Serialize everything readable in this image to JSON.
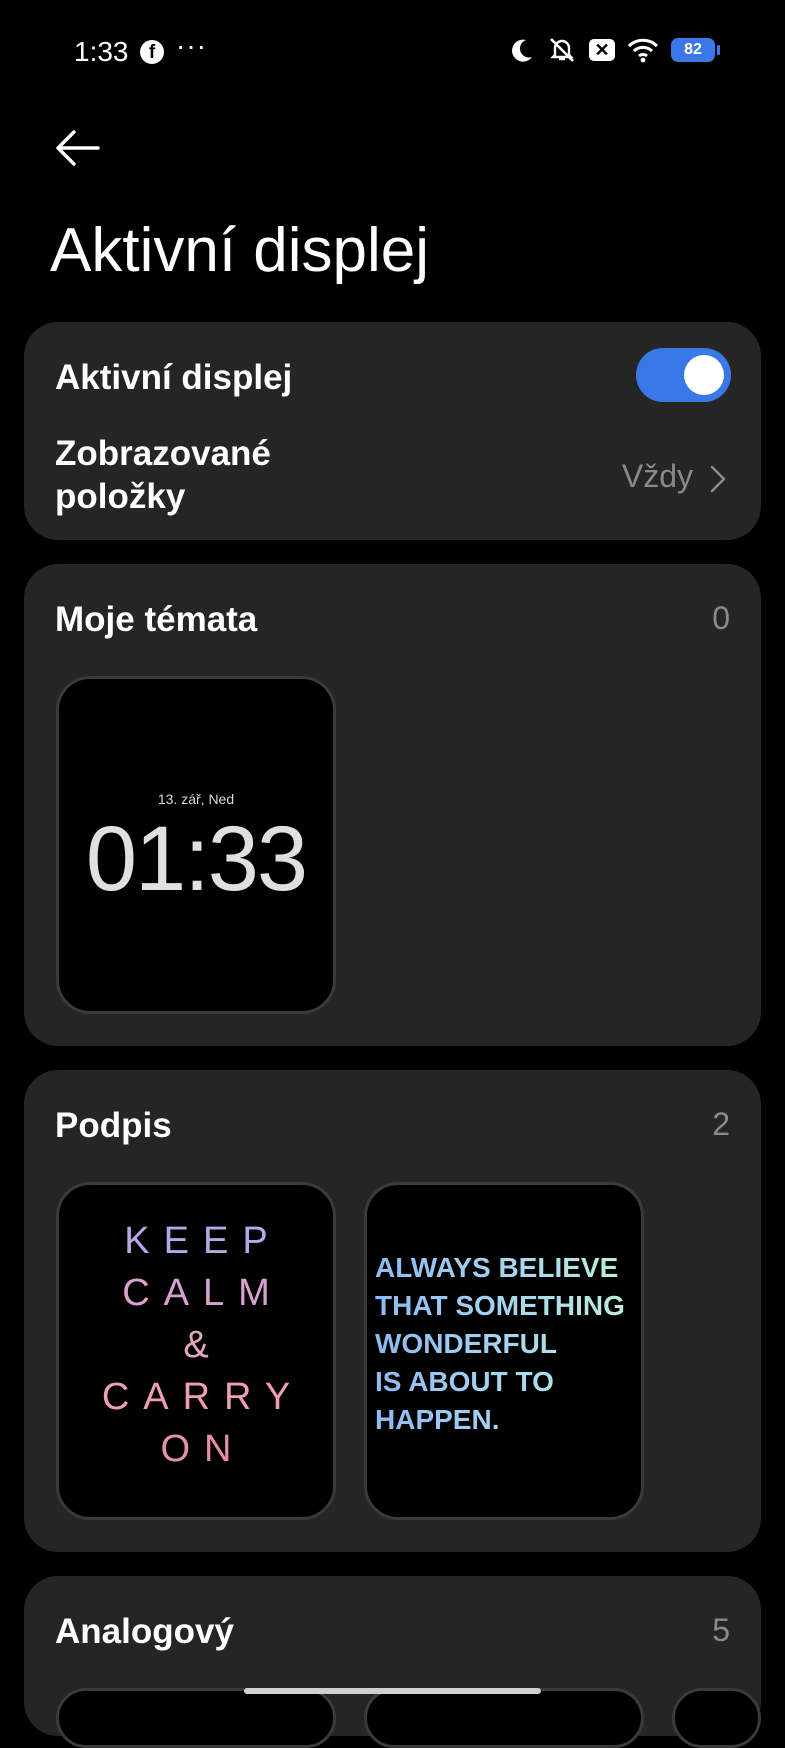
{
  "status": {
    "time": "1:33",
    "dots": "···",
    "battery": "82"
  },
  "header": {
    "title": "Aktivní displej"
  },
  "settings": {
    "toggle_label": "Aktivní displej",
    "toggle_on": true,
    "items_label_line1": "Zobrazované",
    "items_label_line2": "položky",
    "items_value": "Vždy"
  },
  "sections": [
    {
      "title": "Moje témata",
      "count": "0"
    },
    {
      "title": "Podpis",
      "count": "2"
    },
    {
      "title": "Analogový",
      "count": "5"
    }
  ],
  "my_theme": {
    "date": "13. zář, Ned",
    "time": "01:33"
  },
  "signature_1": {
    "lines": [
      "KEEP",
      "CALM",
      "&",
      "CARRY",
      "ON"
    ],
    "colors": [
      "#b9a6e6",
      "#d7a2d3",
      "#e3a6c0",
      "#ee9fb3",
      "#e68fa7"
    ]
  },
  "signature_2": {
    "lines": [
      "ALWAYS BELIEVE",
      "THAT SOMETHING",
      "WONDERFUL",
      "IS ABOUT TO",
      "HAPPEN."
    ]
  },
  "colors": {
    "accent": "#3b78e7",
    "card": "#252525",
    "background": "#000000"
  }
}
